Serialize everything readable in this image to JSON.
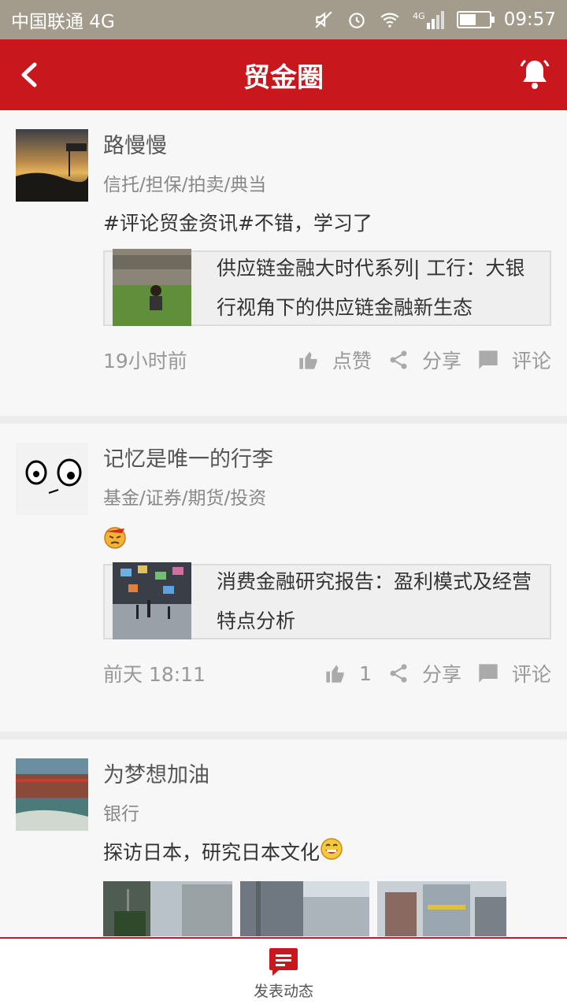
{
  "status_bar": {
    "carrier": "中国联通 4G",
    "network": "4G",
    "time": "09:57",
    "battery_level": 0.55
  },
  "header": {
    "title": "贸金圈",
    "back_icon": "chevron-left-icon",
    "bell_icon": "bell-icon"
  },
  "posts": [
    {
      "name": "路慢慢",
      "tags": "信托/担保/拍卖/典当",
      "text": "#评论贸金资讯#不错，学习了",
      "link_title": "供应链金融大时代系列| 工行：大银行视角下的供应链金融新生态",
      "time": "19小时前",
      "like_label": "点赞",
      "share_label": "分享",
      "comment_label": "评论"
    },
    {
      "name": "记忆是唯一的行李",
      "tags": "基金/证券/期货/投资",
      "text": "",
      "emoji": "angry-face-emoji",
      "link_title": "消费金融研究报告：盈利模式及经营特点分析",
      "time": "前天 18:11",
      "like_label": "1",
      "share_label": "分享",
      "comment_label": "评论"
    },
    {
      "name": "为梦想加油",
      "tags": "银行",
      "text": "探访日本，研究日本文化",
      "emoji": "grinning-face-emoji"
    }
  ],
  "bottom_bar": {
    "publish_label": "发表动态"
  },
  "colors": {
    "brand_red": "#c9171e",
    "status_bar": "#a39c8c"
  }
}
